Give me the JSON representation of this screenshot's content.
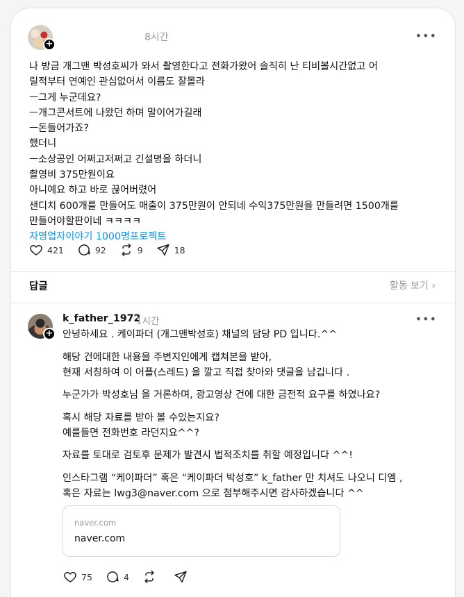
{
  "post": {
    "time": "8시간",
    "body_lines": [
      "나 방금 개그맨 박성호씨가 와서 촬영한다고 전화가왔어 솔직히 난 티비볼시간없고 어",
      "릴적부터 연예인 관심없어서 이름도 잘몰라",
      "ㅡ그게 누군데요?",
      "ㅡ개그콘서트에 나왔던 하며 말이어가길래",
      "ㅡ돈들어가죠?",
      "했더니",
      "ㅡ소상공인 어쩌고저쩌고 긴설명을 하더니",
      "촬영비 375만원이요",
      "아니예요 하고 바로 끊어버렸어",
      "샌디치 600개를 만들어도 매출이 375만원이 안되네 수익375만원을 만들려면 1500개를",
      "만들어야할판이네 ㅋㅋㅋㅋ"
    ],
    "hashtag": "자영업자이야기 1000명프로젝트",
    "likes": "421",
    "comments": "92",
    "reposts": "9",
    "shares": "18"
  },
  "replies_section": {
    "label": "답글",
    "activity_link": "활동 보기 ›"
  },
  "reply": {
    "username": "k_father_1972",
    "time": "1시간",
    "first_line": "안녕하세요 . 케이파더 (개그맨박성호) 채널의 담당 PD 입니다.^^",
    "paragraphs": [
      [
        "해당 건에대한 내용을 주변지인에게 캡쳐본을 받아,",
        "현재 서칭하여 이 어플(스레드) 을 깔고 직접 찾아와 댓글을 남깁니다 ."
      ],
      [
        "누군가가 박성호님 을 거론하며, 광고영상 건에 대한 금전적 요구를 하였나요?"
      ],
      [
        "혹시 해당 자료를 받아 볼 수있는지요?",
        "예를들면 전화번호 라던지요^^?"
      ],
      [
        "자료를 토대로 검토후 문제가 발견시 법적조치를 취할 예정입니다 ^^!"
      ],
      [
        "인스타그램 “케이파더” 혹은 “케이파더 박성호” k_father 만 치셔도 나오니 디엠 ,",
        "혹은 자료는 lwg3@naver.com 으로 첨부해주시면 감사하겠습니다 ^^"
      ]
    ],
    "link_card": {
      "domain_small": "naver.com",
      "domain_main": "naver.com"
    },
    "likes": "75",
    "comments": "4"
  },
  "icons": {
    "more": "more-dots-icon",
    "like": "heart-icon",
    "comment": "comment-bubble-icon",
    "repost": "repost-icon",
    "share": "send-icon",
    "follow": "plus-icon"
  }
}
